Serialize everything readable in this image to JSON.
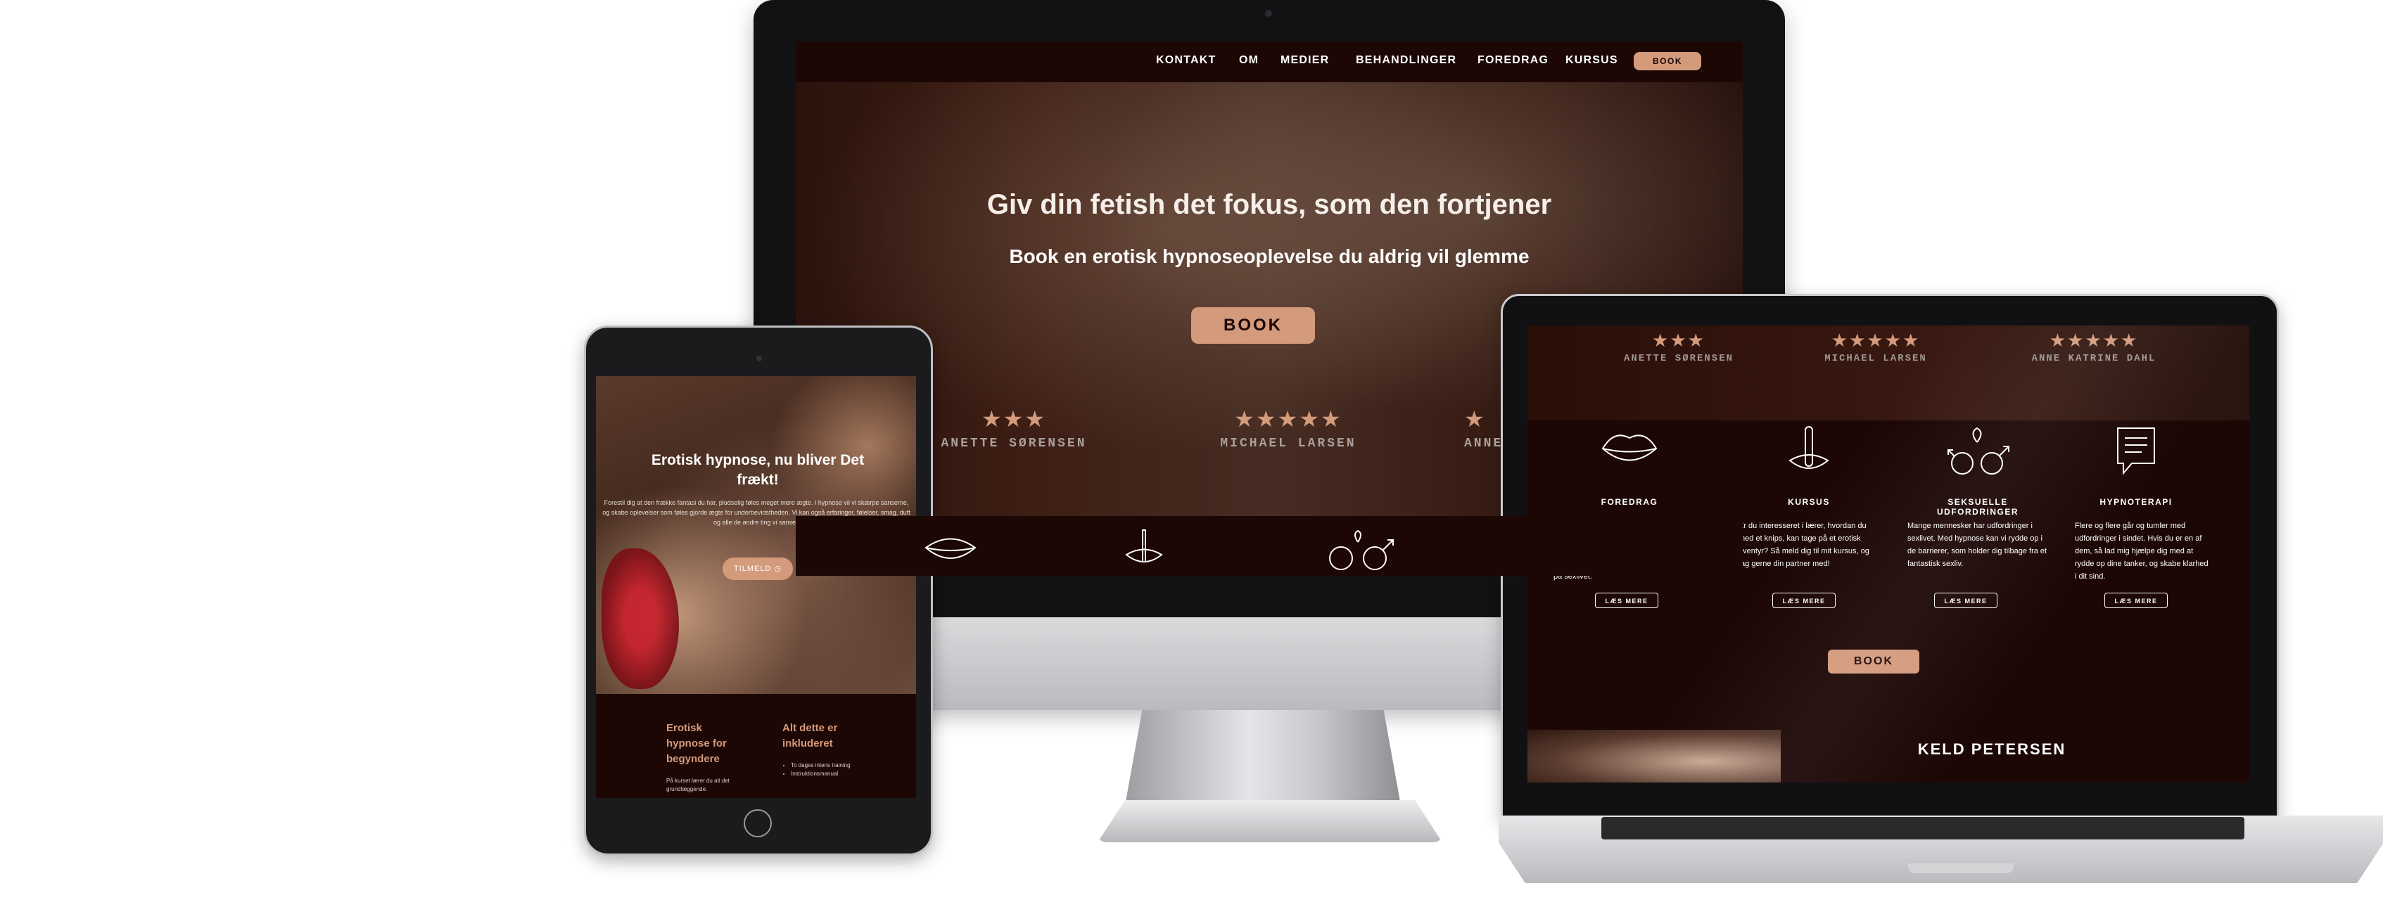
{
  "desktop": {
    "nav": [
      "KONTAKT",
      "OM",
      "MEDIER",
      "BEHANDLINGER",
      "FOREDRAG",
      "KURSUS"
    ],
    "nav_book": "BOOK",
    "hero_title": "Giv din fetish det fokus, som den fortjener",
    "hero_subtitle": "Book en erotisk hypnoseoplevelse du aldrig vil glemme",
    "book_button": "BOOK",
    "reviews": [
      {
        "stars": "★★★",
        "name": "ANETTE SØRENSEN"
      },
      {
        "stars": "★★★★★",
        "name": "MICHAEL LARSEN"
      },
      {
        "stars": "★",
        "name": "ANNE"
      }
    ]
  },
  "tablet": {
    "hero_title": "Erotisk hypnose, nu bliver Det frækt!",
    "hero_text": "Forestil dig at den frække fantasi du har, pludselig føles meget mere ægte. I hypnose vil vi skærpe sanserne, og skabe oplevelser som føles gjorde ægte for underbevidstheden. Vi kan også erfaringer, følelser, smag, duft og alle de andre ting vi sanser.",
    "hero_button": "TILMELD",
    "col1_title": "Erotisk hypnose for begyndere",
    "col1_text": "På kurset lærer du alt det grundlæggende.",
    "col2_title": "Alt dette er inkluderet",
    "col2_items": [
      "To dages intens training",
      "Instruktionsmanual"
    ]
  },
  "laptop": {
    "reviews": [
      {
        "stars": "★★★",
        "name": "ANETTE SØRENSEN"
      },
      {
        "stars": "★★★★★",
        "name": "MICHAEL LARSEN"
      },
      {
        "stars": "★★★★★",
        "name": "ANNE KATRINE DAHL"
      }
    ],
    "services": [
      {
        "icon": "lips-icon",
        "title": "FOREDRAG",
        "text": "Måske du er nysgerrig på erotisk hypnose? Så duk op til et af mine foredrag, hvor du vil lærer om de mange måder, vi kan bruge hypnose i soveværelset, til leg og krymmel på sexlivet.",
        "button": "LÆS MERE"
      },
      {
        "icon": "finger-lips-icon",
        "title": "KURSUS",
        "text": "Er du interesseret i lærer, hvordan du med et knips, kan tage på et erotisk eventyr? Så meld dig til mit kursus, og tag gerne din partner med!",
        "button": "LÆS MERE"
      },
      {
        "icon": "gender-symbols-icon",
        "title": "SEKSUELLE UDFORDRINGER",
        "text": "Mange mennesker har udfordringer i sexlivet. Med hypnose kan vi rydde op i de barrierer, som holder dig tilbage fra et fantastisk sexliv.",
        "button": "LÆS MERE"
      },
      {
        "icon": "speech-icon",
        "title": "HYPNOTERAPI",
        "text": "Flere og flere går og tumler med udfordringer i sindet. Hvis du er en af dem, så lad mig hjælpe dig med at rydde op dine tanker, og skabe klarhed i dit sind.",
        "button": "LÆS MERE"
      }
    ],
    "book_button": "BOOK",
    "next_title": "KELD PETERSEN"
  },
  "colors": {
    "accent": "#d49a7c",
    "dark": "#1c0705"
  }
}
